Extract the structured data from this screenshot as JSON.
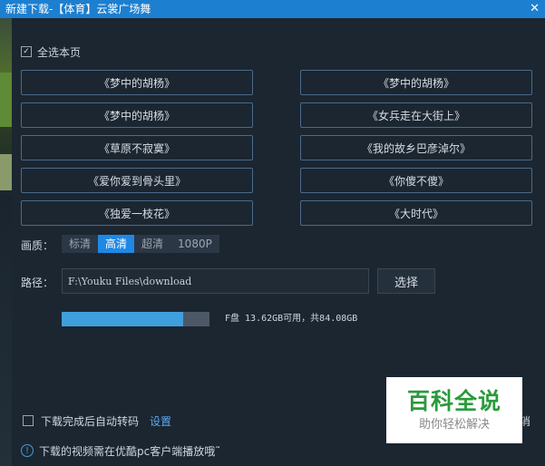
{
  "window": {
    "title": "新建下载-【体育】云裳广场舞",
    "close_symbol": "✕"
  },
  "select_all": {
    "checked": true,
    "check_mark": "✓",
    "label": "全选本页"
  },
  "songs": [
    "《梦中的胡杨》",
    "《梦中的胡杨》",
    "《梦中的胡杨》",
    "《女兵走在大街上》",
    "《草原不寂寞》",
    "《我的故乡巴彦淖尔》",
    "《爱你爱到骨头里》",
    "《你傻不傻》",
    "《独爱一枝花》",
    "《大时代》"
  ],
  "quality": {
    "label": "画质：",
    "options": [
      "标清",
      "高清",
      "超清",
      "1080P"
    ],
    "selected": "高清"
  },
  "path": {
    "label": "路径：",
    "value": "F:\\Youku Files\\download",
    "choose_button": "选择"
  },
  "storage": {
    "used_fraction": 0.82,
    "info": "F盘 13.62GB可用，共84.08GB",
    "bar_color": "#3f9fdc"
  },
  "auto_convert": {
    "checked": false,
    "label": "下载完成后自动转码",
    "settings_link": "设置"
  },
  "notice": {
    "icon": "info-icon",
    "text": "下载的视频需在优酷pc客户端播放哦˜"
  },
  "partial_button_text": "消",
  "watermark": {
    "title": "百科全说",
    "subtitle": "助你轻松解决"
  }
}
